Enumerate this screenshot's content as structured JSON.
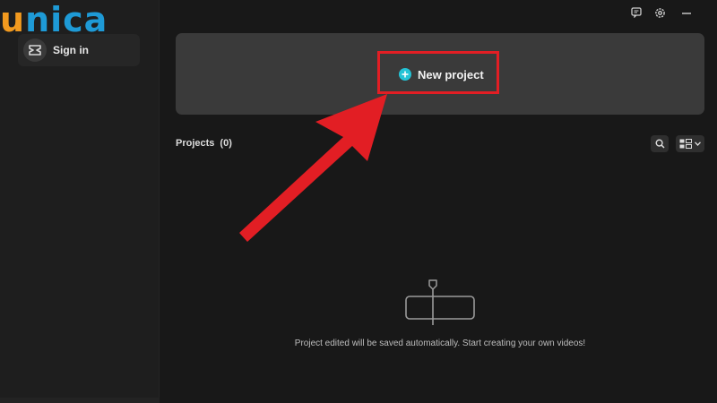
{
  "logo": {
    "text_first": "u",
    "text_rest": "nica",
    "accent_orange": "#f29a1f",
    "accent_blue": "#1e9ad6"
  },
  "sidebar": {
    "signin_label": "Sign in"
  },
  "window": {
    "icons": [
      "feedback-icon",
      "settings-icon",
      "minimize-icon"
    ]
  },
  "banner": {
    "new_project_label": "New project",
    "plus_color": "#23c3d6",
    "highlight_color": "#e21e24"
  },
  "projects": {
    "title": "Projects",
    "count": "(0)"
  },
  "empty_state": {
    "message": "Project edited will be saved automatically. Start creating your own videos!"
  },
  "annotation": {
    "arrow_color": "#e21e24"
  }
}
